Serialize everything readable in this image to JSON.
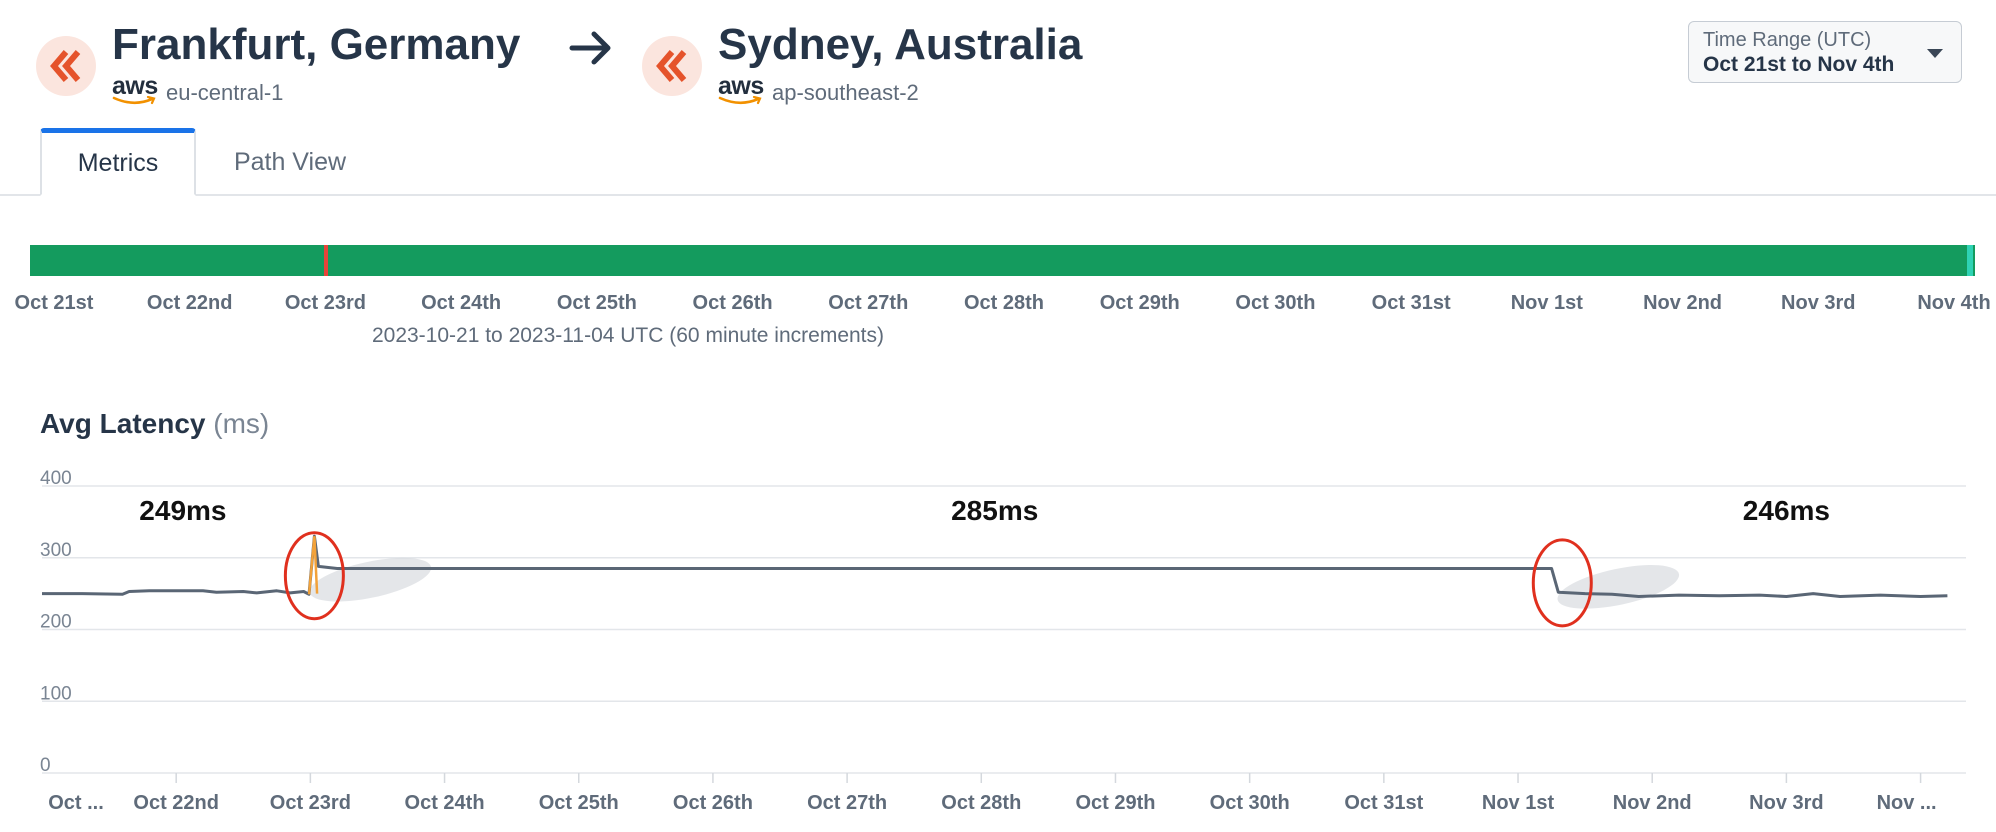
{
  "header": {
    "source": {
      "name": "Frankfurt, Germany",
      "provider": "aws",
      "region": "eu-central-1"
    },
    "destination": {
      "name": "Sydney, Australia",
      "provider": "aws",
      "region": "ap-southeast-2"
    },
    "icons": {
      "endpoint": "chevron-left-double-icon",
      "direction": "arrow-right-icon",
      "dropdown": "caret-down-icon"
    }
  },
  "time_range": {
    "label": "Time Range (UTC)",
    "value": "Oct 21st to Nov 4th"
  },
  "tabs": [
    {
      "label": "Metrics",
      "active": true
    },
    {
      "label": "Path View",
      "active": false
    }
  ],
  "colors": {
    "accent": "#1a73e8",
    "healthy": "#149b5e",
    "incident": "#e8443a",
    "logo": "#e5532b",
    "series": "#5a6675",
    "annotation": "#e0301e"
  },
  "status_timeline": {
    "labels": [
      "Oct 21st",
      "Oct 22nd",
      "Oct 23rd",
      "Oct 24th",
      "Oct 25th",
      "Oct 26th",
      "Oct 27th",
      "Oct 28th",
      "Oct 29th",
      "Oct 30th",
      "Oct 31st",
      "Nov 1st",
      "Nov 2nd",
      "Nov 3rd",
      "Nov 4th"
    ],
    "caption": "2023-10-21 to 2023-11-04 UTC (60 minute increments)",
    "incident_day": 2.0
  },
  "chart_data": {
    "type": "line",
    "title": "Avg Latency",
    "unit": "(ms)",
    "xlabel": "",
    "ylabel": "",
    "x_labels": [
      "Oct ...",
      "Oct 22nd",
      "Oct 23rd",
      "Oct 24th",
      "Oct 25th",
      "Oct 26th",
      "Oct 27th",
      "Oct 28th",
      "Oct 29th",
      "Oct 30th",
      "Oct 31st",
      "Nov 1st",
      "Nov 2nd",
      "Nov 3rd",
      "Nov ..."
    ],
    "ylim": [
      0,
      400
    ],
    "yticks": [
      0,
      100,
      200,
      300,
      400
    ],
    "grid": true,
    "series": [
      {
        "points": [
          [
            0.0,
            250
          ],
          [
            0.3,
            250
          ],
          [
            0.6,
            249
          ],
          [
            0.65,
            253
          ],
          [
            0.8,
            254
          ],
          [
            1.0,
            254
          ],
          [
            1.2,
            254
          ],
          [
            1.3,
            252
          ],
          [
            1.5,
            253
          ],
          [
            1.6,
            251
          ],
          [
            1.75,
            254
          ],
          [
            1.85,
            251
          ],
          [
            1.95,
            253
          ],
          [
            1.99,
            249
          ],
          [
            2.03,
            330
          ],
          [
            2.06,
            288
          ],
          [
            2.2,
            285
          ],
          [
            3.0,
            285
          ],
          [
            4.0,
            285
          ],
          [
            5.0,
            285
          ],
          [
            6.0,
            285
          ],
          [
            7.0,
            285
          ],
          [
            8.0,
            285
          ],
          [
            9.0,
            285
          ],
          [
            10.0,
            285
          ],
          [
            10.7,
            285
          ],
          [
            11.25,
            285
          ],
          [
            11.3,
            252
          ],
          [
            11.5,
            250
          ],
          [
            11.7,
            249
          ],
          [
            11.9,
            246
          ],
          [
            12.2,
            248
          ],
          [
            12.5,
            247
          ],
          [
            12.8,
            248
          ],
          [
            13.0,
            246
          ],
          [
            13.2,
            250
          ],
          [
            13.4,
            246
          ],
          [
            13.7,
            248
          ],
          [
            14.0,
            246
          ],
          [
            14.2,
            247
          ]
        ]
      }
    ],
    "annotations": [
      {
        "text": "249ms",
        "x": 1.05,
        "y": 390
      },
      {
        "text": "285ms",
        "x": 7.1,
        "y": 390
      },
      {
        "text": "246ms",
        "x": 13.0,
        "y": 390
      }
    ],
    "highlights": [
      {
        "x": 2.0,
        "y": 275
      },
      {
        "x": 11.3,
        "y": 265
      }
    ]
  }
}
